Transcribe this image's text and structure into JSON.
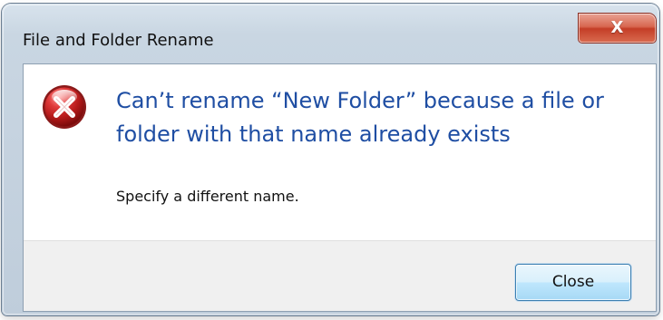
{
  "window": {
    "title": "File and Folder Rename",
    "close_button_label": "X"
  },
  "message": {
    "headline": "Can’t rename “New Folder” because a file or folder with that name already exists",
    "subtext": "Specify a different name."
  },
  "footer": {
    "close_label": "Close"
  },
  "icons": {
    "error": "error-icon",
    "close": "close-icon"
  },
  "colors": {
    "headline": "#1f4ea3",
    "error_red": "#c62f2f",
    "button_blue": "#bee6fd"
  }
}
